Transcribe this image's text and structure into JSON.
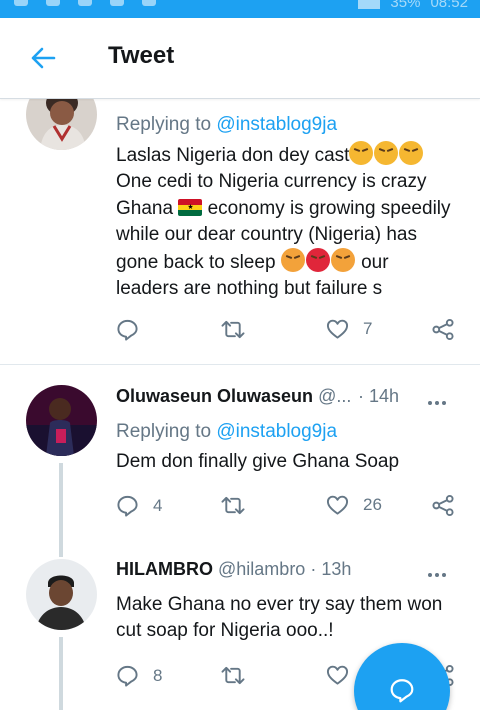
{
  "status_bar": {
    "battery": "35%",
    "time": "08:52"
  },
  "header": {
    "title": "Tweet",
    "back_icon": "arrow-left-icon"
  },
  "tweets": [
    {
      "replying_label": "Replying to",
      "replying_to": "@instablog9ja",
      "text_lines": [
        "Laslas Nigeria don dey cast",
        "One cedi to  Nigeria currency is crazy",
        "Ghana",
        "economy is growing speedily",
        "while our dear country (Nigeria) has",
        "gone back to sleep",
        "our",
        "leaders are nothing but failure s"
      ],
      "emojis": [
        "tired-face-emoji",
        "ghana-flag-emoji",
        "angry-face-emoji",
        "pouting-face-emoji"
      ],
      "likes": "7"
    },
    {
      "name": "Oluwaseun Oluwaseun",
      "handle": "@...",
      "time": "· 14h",
      "replying_label": "Replying to",
      "replying_to": "@instablog9ja",
      "text": "Dem don finally give Ghana Soap",
      "replies": "4",
      "likes": "26"
    },
    {
      "name": "HILAMBRO",
      "handle": "@hilambro",
      "time": "· 13h",
      "text_lines": [
        "Make Ghana no ever try say them won",
        "cut soap for Nigeria ooo..!"
      ],
      "replies": "8"
    }
  ],
  "fab": {
    "icon": "compose-reply-icon"
  },
  "colors": {
    "accent": "#1da1f2",
    "text": "#14171a",
    "muted": "#657786"
  }
}
